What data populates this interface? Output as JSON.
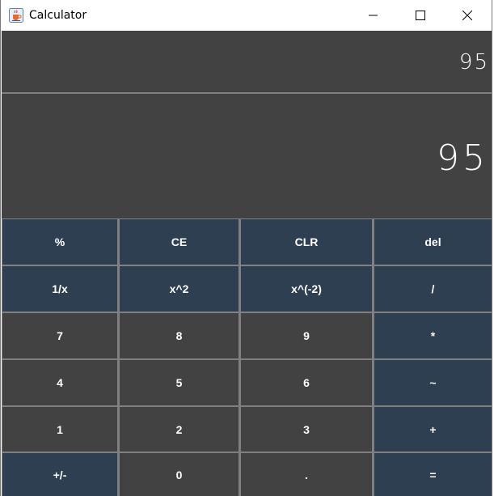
{
  "window": {
    "title": "Calculator",
    "icon": "java-cup-icon",
    "controls": [
      "minimize-icon",
      "maximize-icon",
      "close-icon"
    ]
  },
  "display": {
    "expression": "95",
    "result": "95"
  },
  "keypad": {
    "rows": [
      [
        "%",
        "CE",
        "CLR",
        "del"
      ],
      [
        "1/x",
        "x^2",
        "x^(-2)",
        "/"
      ],
      [
        "7",
        "8",
        "9",
        "*"
      ],
      [
        "4",
        "5",
        "6",
        "~"
      ],
      [
        "1",
        "2",
        "3",
        "+"
      ],
      [
        "+/-",
        "0",
        ".",
        "="
      ]
    ]
  },
  "colors": {
    "operator_key": "#2e3f52",
    "digit_key": "#424242",
    "display_bg": "#424242",
    "separator": "#808080"
  }
}
